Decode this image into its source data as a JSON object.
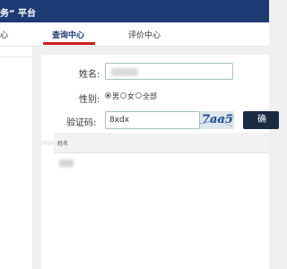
{
  "header": {
    "brand_text": "务” 平台",
    "bg_color": "#1c3b73"
  },
  "nav": {
    "items": [
      {
        "label": "心"
      },
      {
        "label": "查询中心"
      },
      {
        "label": "评价中心"
      }
    ],
    "active_index": 1,
    "active_color": "#c81e1e"
  },
  "form": {
    "name_label": "姓名:",
    "name_value": "",
    "gender_label": "性别:",
    "gender_options": [
      "男",
      "女",
      "全部"
    ],
    "gender_selected": "男",
    "captcha_label": "验证码:",
    "captcha_value": "8xdx",
    "captcha_image_text": "7aa5",
    "confirm_label": "确"
  },
  "results": {
    "columns": [
      "姓名"
    ]
  }
}
